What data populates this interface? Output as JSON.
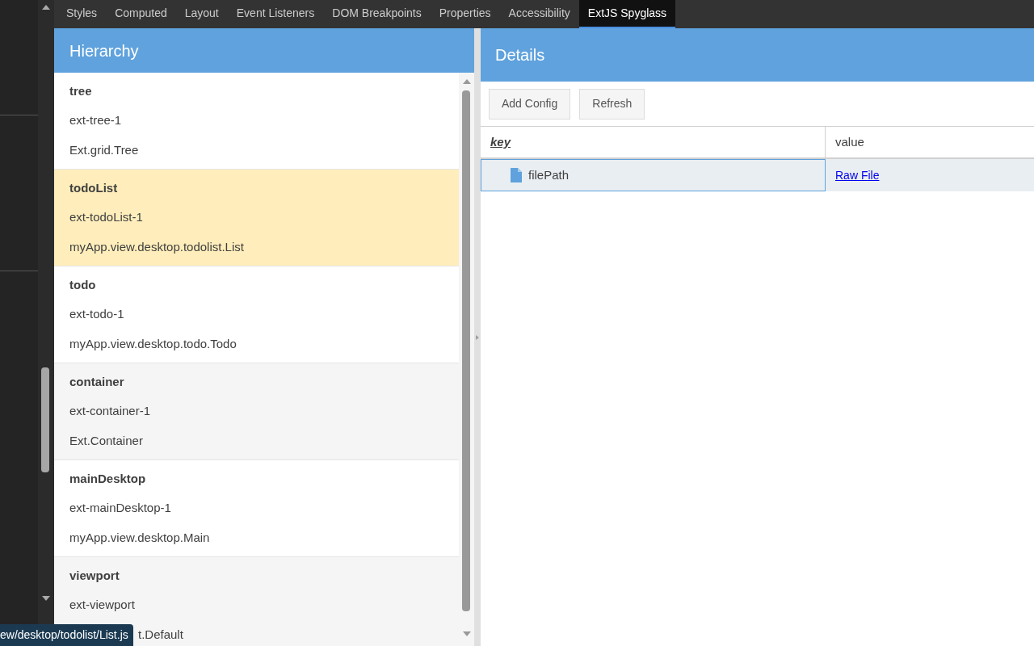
{
  "tabs": [
    {
      "label": "Styles",
      "selected": false
    },
    {
      "label": "Computed",
      "selected": false
    },
    {
      "label": "Layout",
      "selected": false
    },
    {
      "label": "Event Listeners",
      "selected": false
    },
    {
      "label": "DOM Breakpoints",
      "selected": false
    },
    {
      "label": "Properties",
      "selected": false
    },
    {
      "label": "Accessibility",
      "selected": false
    },
    {
      "label": "ExtJS Spyglass",
      "selected": true
    }
  ],
  "hierarchy": {
    "title": "Hierarchy",
    "items": [
      {
        "name": "tree",
        "id": "ext-tree-1",
        "class": "Ext.grid.Tree",
        "selected": false
      },
      {
        "name": "todoList",
        "id": "ext-todoList-1",
        "class": "myApp.view.desktop.todolist.List",
        "selected": true
      },
      {
        "name": "todo",
        "id": "ext-todo-1",
        "class": "myApp.view.desktop.todo.Todo",
        "selected": false
      },
      {
        "name": "container",
        "id": "ext-container-1",
        "class": "Ext.Container",
        "selected": false
      },
      {
        "name": "mainDesktop",
        "id": "ext-mainDesktop-1",
        "class": "myApp.view.desktop.Main",
        "selected": false
      },
      {
        "name": "viewport",
        "id": "ext-viewport",
        "class": "t.Default",
        "selected": false
      }
    ]
  },
  "details": {
    "title": "Details",
    "buttons": [
      "Add Config",
      "Refresh"
    ],
    "columns": [
      "key",
      "value"
    ],
    "rows": [
      {
        "key": "filePath",
        "value": "Raw File",
        "selected": true
      }
    ]
  },
  "tooltip": "ew/desktop/todolist/List.js"
}
